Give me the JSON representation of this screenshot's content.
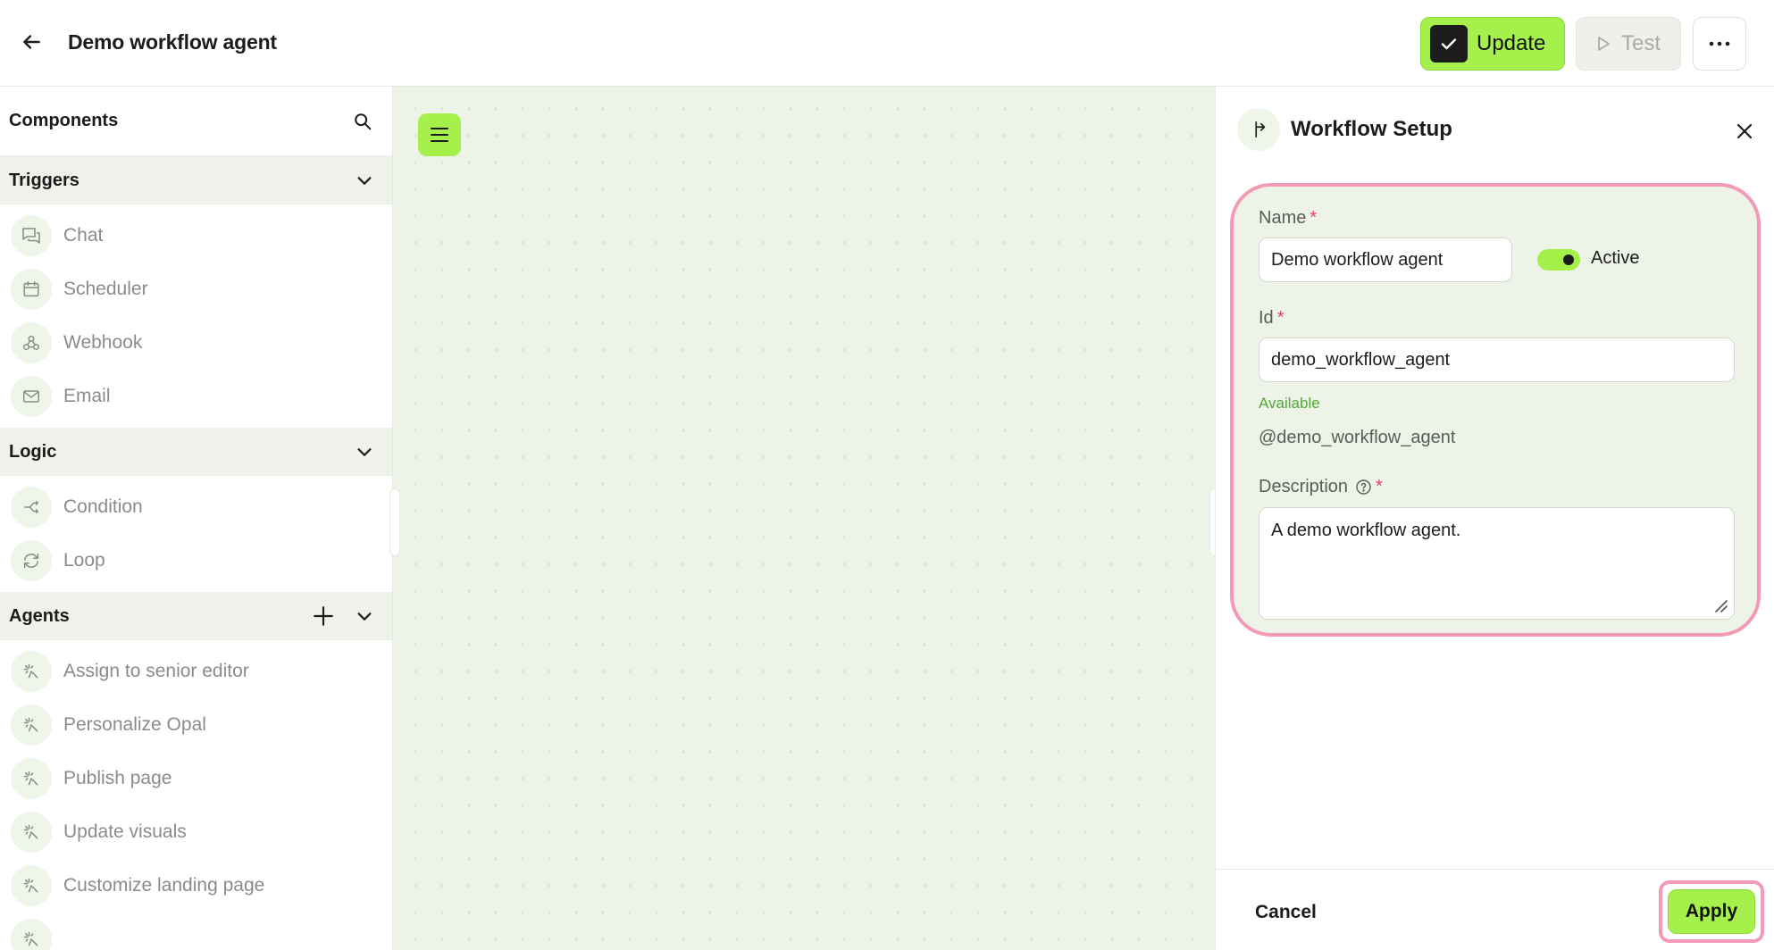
{
  "header": {
    "title": "Demo workflow agent",
    "update_label": "Update",
    "test_label": "Test"
  },
  "sidebar": {
    "title": "Components",
    "sections": [
      {
        "name": "Triggers",
        "items": [
          "Chat",
          "Scheduler",
          "Webhook",
          "Email"
        ]
      },
      {
        "name": "Logic",
        "items": [
          "Condition",
          "Loop"
        ]
      },
      {
        "name": "Agents",
        "items": [
          "Assign to senior editor",
          "Personalize Opal",
          "Publish page",
          "Update visuals",
          "Customize landing page"
        ]
      }
    ]
  },
  "panel": {
    "title": "Workflow Setup",
    "name_label": "Name",
    "name_value": "Demo workflow agent",
    "active_label": "Active",
    "id_label": "Id",
    "id_value": "demo_workflow_agent",
    "availability": "Available",
    "handle": "@demo_workflow_agent",
    "description_label": "Description",
    "description_value": "A demo workflow agent.",
    "required_mark": "*",
    "cancel_label": "Cancel",
    "apply_label": "Apply"
  },
  "colors": {
    "accent": "#a5f04a",
    "highlight": "#f39ab4",
    "available": "#52a83a",
    "required": "#e0445a"
  },
  "icons": {
    "back": "arrow-left-icon",
    "update": "check-icon",
    "test": "play-icon",
    "more": "more-horizontal-icon",
    "search": "search-icon",
    "chevron": "chevron-down-icon",
    "plus": "plus-icon",
    "chat": "chat-icon",
    "scheduler": "calendar-icon",
    "webhook": "webhook-icon",
    "email": "mail-icon",
    "condition": "branch-icon",
    "loop": "loop-icon",
    "agent": "sparkle-icon",
    "menu": "hamburger-icon",
    "workflow": "workflow-icon",
    "close": "close-icon",
    "help": "help-circle-icon"
  }
}
